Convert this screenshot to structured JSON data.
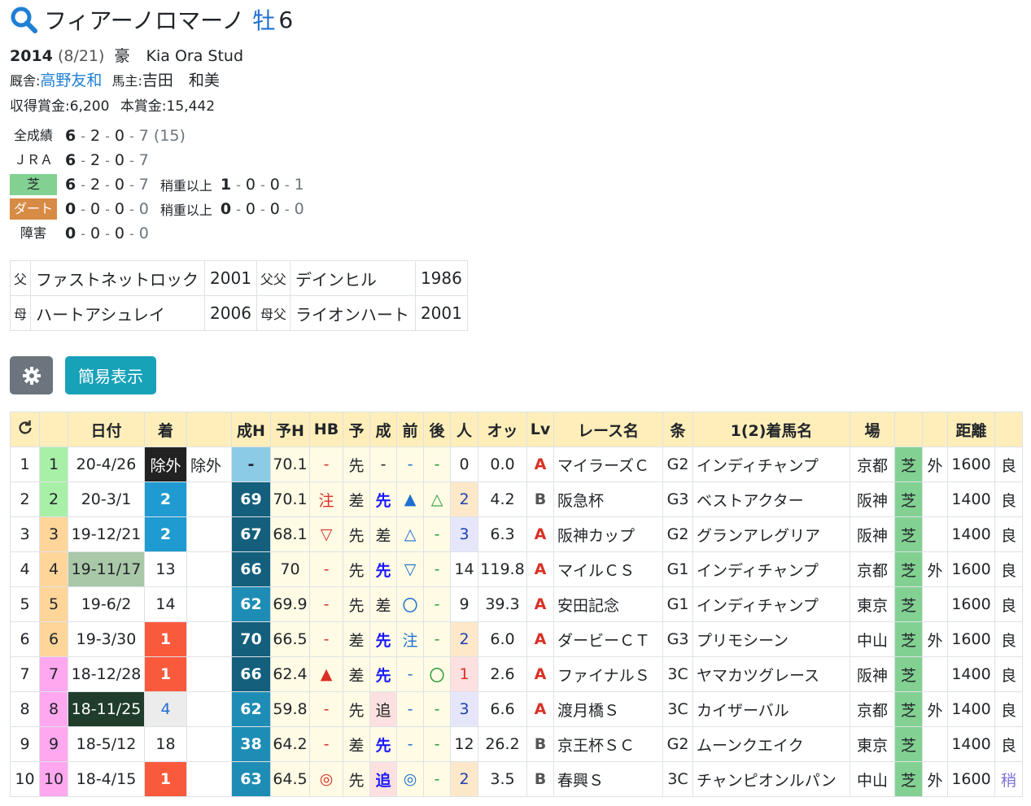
{
  "horse": {
    "name": "フィアーノロマーノ",
    "sex": "牡",
    "age": "6"
  },
  "profile": {
    "year": "2014",
    "date": "(8/21)",
    "country": "豪",
    "breeder": "Kia Ora Stud",
    "stable_label": "厩舎:",
    "trainer": "高野友和",
    "owner_label": "馬主:",
    "owner": "吉田　和美",
    "earn_label": "収得賞金:",
    "earn": "6,200",
    "prize_label": "本賞金:",
    "prize": "15,442"
  },
  "records": [
    {
      "label": "全成績",
      "a": "6",
      "b": "2",
      "c": "0",
      "d": "7",
      "extra": "(15)",
      "sub_label": "",
      "sa": "",
      "sb": "",
      "sc": "",
      "sd": ""
    },
    {
      "label": "ＪＲＡ",
      "a": "6",
      "b": "2",
      "c": "0",
      "d": "7",
      "extra": "",
      "sub_label": "",
      "sa": "",
      "sb": "",
      "sc": "",
      "sd": ""
    },
    {
      "label": "芝",
      "a": "6",
      "b": "2",
      "c": "0",
      "d": "7",
      "extra": "",
      "sub_label": "稍重以上",
      "sa": "1",
      "sb": "0",
      "sc": "0",
      "sd": "1"
    },
    {
      "label": "ダート",
      "a": "0",
      "b": "0",
      "c": "0",
      "d": "0",
      "extra": "",
      "sub_label": "稍重以上",
      "sa": "0",
      "sb": "0",
      "sc": "0",
      "sd": "0"
    },
    {
      "label": "障害",
      "a": "0",
      "b": "0",
      "c": "0",
      "d": "0",
      "extra": "",
      "sub_label": "",
      "sa": "",
      "sb": "",
      "sc": "",
      "sd": ""
    }
  ],
  "pedigree": {
    "sire_label": "父",
    "sire": "ファストネットロック",
    "sire_year": "2001",
    "sire_sire_label": "父父",
    "sire_sire": "デインヒル",
    "sire_sire_year": "1986",
    "dam_label": "母",
    "dam": "ハートアシュレイ",
    "dam_year": "2006",
    "dam_sire_label": "母父",
    "dam_sire": "ライオンハート",
    "dam_sire_year": "2001"
  },
  "buttons": {
    "simple": "簡易表示",
    "gear_icon": "gear-icon"
  },
  "table": {
    "headers": [
      "",
      "",
      "日付",
      "着",
      "",
      "成H",
      "予H",
      "HB",
      "予",
      "成",
      "前",
      "後",
      "人",
      "オッ",
      "Lv",
      "レース名",
      "条",
      "1(2)着馬名",
      "場",
      "",
      "",
      "距離",
      "",
      ""
    ],
    "rows": [
      {
        "no": "1",
        "w": "1",
        "date": "20-4/26",
        "pos": "除外",
        "pos2": "除外",
        "sh": "-",
        "yh": "70.1",
        "hb": "-",
        "yo": "先",
        "sei": "-",
        "mae": "-",
        "ato": "-",
        "pop": "0",
        "odds": "0.0",
        "lv": "A",
        "race": "マイラーズＣ",
        "grade": "G2",
        "winner": "インディチャンプ",
        "venue": "京都",
        "surf": "芝",
        "io": "外",
        "dist": "1600",
        "cond": "良"
      },
      {
        "no": "2",
        "w": "2",
        "date": "20-3/1",
        "pos": "2",
        "pos2": "",
        "sh": "69",
        "yh": "70.1",
        "hb": "注",
        "yo": "差",
        "sei": "先",
        "mae": "▲",
        "ato": "△",
        "pop": "2",
        "odds": "4.2",
        "lv": "B",
        "race": "阪急杯",
        "grade": "G3",
        "winner": "ベストアクター",
        "venue": "阪神",
        "surf": "芝",
        "io": "",
        "dist": "1400",
        "cond": "良"
      },
      {
        "no": "3",
        "w": "3",
        "date": "19-12/21",
        "pos": "2",
        "pos2": "",
        "sh": "67",
        "yh": "68.1",
        "hb": "▽",
        "yo": "先",
        "sei": "差",
        "mae": "△",
        "ato": "-",
        "pop": "3",
        "odds": "6.3",
        "lv": "A",
        "race": "阪神カップ",
        "grade": "G2",
        "winner": "グランアレグリア",
        "venue": "阪神",
        "surf": "芝",
        "io": "",
        "dist": "1400",
        "cond": "良"
      },
      {
        "no": "4",
        "w": "4",
        "date": "19-11/17",
        "pos": "13",
        "pos2": "",
        "sh": "66",
        "yh": "70",
        "hb": "-",
        "yo": "先",
        "sei": "先",
        "mae": "▽",
        "ato": "-",
        "pop": "14",
        "odds": "119.8",
        "lv": "A",
        "race": "マイルＣＳ",
        "grade": "G1",
        "winner": "インディチャンプ",
        "venue": "京都",
        "surf": "芝",
        "io": "外",
        "dist": "1600",
        "cond": "良"
      },
      {
        "no": "5",
        "w": "5",
        "date": "19-6/2",
        "pos": "14",
        "pos2": "",
        "sh": "62",
        "yh": "69.9",
        "hb": "-",
        "yo": "先",
        "sei": "差",
        "mae": "〇",
        "ato": "-",
        "pop": "9",
        "odds": "39.3",
        "lv": "A",
        "race": "安田記念",
        "grade": "G1",
        "winner": "インディチャンプ",
        "venue": "東京",
        "surf": "芝",
        "io": "",
        "dist": "1600",
        "cond": "良"
      },
      {
        "no": "6",
        "w": "6",
        "date": "19-3/30",
        "pos": "1",
        "pos2": "",
        "sh": "70",
        "yh": "66.5",
        "hb": "-",
        "yo": "差",
        "sei": "先",
        "mae": "注",
        "ato": "-",
        "pop": "2",
        "odds": "6.0",
        "lv": "A",
        "race": "ダービーＣＴ",
        "grade": "G3",
        "winner": "プリモシーン",
        "venue": "中山",
        "surf": "芝",
        "io": "外",
        "dist": "1600",
        "cond": "良"
      },
      {
        "no": "7",
        "w": "7",
        "date": "18-12/28",
        "pos": "1",
        "pos2": "",
        "sh": "66",
        "yh": "62.4",
        "hb": "▲",
        "yo": "差",
        "sei": "先",
        "mae": "-",
        "ato": "〇",
        "pop": "1",
        "odds": "2.6",
        "lv": "A",
        "race": "ファイナルＳ",
        "grade": "3C",
        "winner": "ヤマカツグレース",
        "venue": "阪神",
        "surf": "芝",
        "io": "",
        "dist": "1400",
        "cond": "良"
      },
      {
        "no": "8",
        "w": "8",
        "date": "18-11/25",
        "pos": "4",
        "pos2": "",
        "sh": "62",
        "yh": "59.8",
        "hb": "-",
        "yo": "先",
        "sei": "追",
        "mae": "-",
        "ato": "-",
        "pop": "3",
        "odds": "6.6",
        "lv": "A",
        "race": "渡月橋Ｓ",
        "grade": "3C",
        "winner": "カイザーバル",
        "venue": "京都",
        "surf": "芝",
        "io": "外",
        "dist": "1400",
        "cond": "良"
      },
      {
        "no": "9",
        "w": "9",
        "date": "18-5/12",
        "pos": "18",
        "pos2": "",
        "sh": "38",
        "yh": "64.2",
        "hb": "-",
        "yo": "差",
        "sei": "先",
        "mae": "-",
        "ato": "-",
        "pop": "12",
        "odds": "26.2",
        "lv": "B",
        "race": "京王杯ＳＣ",
        "grade": "G2",
        "winner": "ムーンクエイク",
        "venue": "東京",
        "surf": "芝",
        "io": "",
        "dist": "1400",
        "cond": "良"
      },
      {
        "no": "10",
        "w": "10",
        "date": "18-4/15",
        "pos": "1",
        "pos2": "",
        "sh": "63",
        "yh": "64.5",
        "hb": "◎",
        "yo": "先",
        "sei": "追",
        "mae": "◎",
        "ato": "-",
        "pop": "2",
        "odds": "3.5",
        "lv": "B",
        "race": "春興Ｓ",
        "grade": "3C",
        "winner": "チャンピオンルパン",
        "venue": "中山",
        "surf": "芝",
        "io": "外",
        "dist": "1600",
        "cond": "稍"
      }
    ]
  },
  "colors": {
    "wk_green": "#a8f0a8",
    "wk_orange": "#ffd59a",
    "wk_pink": "#ffa8f0",
    "pos1": "#fa5a3c",
    "pos2": "#1f9bd1",
    "sh_dark": "#135f7c",
    "sh_mid": "#1e8db5",
    "sh_light": "#8ccbe6"
  }
}
